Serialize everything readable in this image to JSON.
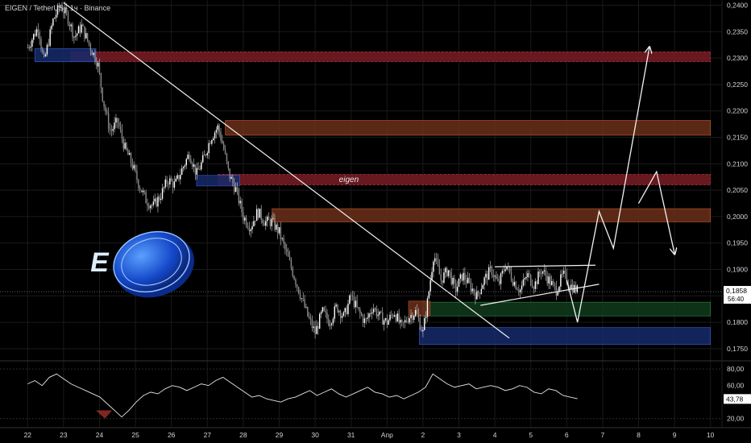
{
  "header": {
    "symbol": "EIGEN / TetherUS · 1ч · Binance"
  },
  "colors": {
    "background": "#000000",
    "text": "#d1d4dc",
    "grid": "#1a1a1a",
    "up": "#e6e6e6",
    "down": "#e6e6e6",
    "supply_zone": "#7a1c24",
    "supply_zone_orange": "#6b2f1a",
    "demand_zone": "#162a6b",
    "green_zone": "#0f3b1c"
  },
  "logo": {
    "name": "eigen-logo",
    "letters": "E"
  },
  "chart_data": {
    "type": "candlestick",
    "title": "",
    "price_axis": {
      "min": 0.173,
      "max": 0.241,
      "ticks": [
        "0,2400",
        "0,2350",
        "0,2300",
        "0,2250",
        "0,2200",
        "0,2150",
        "0,2100",
        "0,2050",
        "0,2000",
        "0,1950",
        "0,1900",
        "0,1850",
        "0,1800",
        "0,1750"
      ],
      "tick_values": [
        0.24,
        0.235,
        0.23,
        0.225,
        0.22,
        0.215,
        0.21,
        0.205,
        0.2,
        0.195,
        0.19,
        0.185,
        0.18,
        0.175
      ],
      "current_price": "0,1858",
      "current_value": 0.1858,
      "countdown": "56:40"
    },
    "time_axis": {
      "labels": [
        "22",
        "23",
        "24",
        "25",
        "26",
        "27",
        "28",
        "29",
        "30",
        "31",
        "Апр",
        "2",
        "3",
        "4",
        "5",
        "6",
        "7",
        "8",
        "9",
        "10"
      ],
      "day_index": [
        0,
        1,
        2,
        3,
        4,
        5,
        6,
        7,
        8,
        9,
        10,
        11,
        12,
        13,
        14,
        15,
        16,
        17,
        18,
        19
      ],
      "first_day_offset": 0.5
    },
    "zones": [
      {
        "label": "",
        "color": "supply",
        "day_from": 1.2,
        "day_to": 19.0,
        "low": 0.2293,
        "high": 0.2312
      },
      {
        "label": "",
        "color": "supply_orange",
        "day_from": 5.5,
        "day_to": 19.0,
        "low": 0.2154,
        "high": 0.2182
      },
      {
        "label": "eigen",
        "color": "supply",
        "day_from": 5.3,
        "day_to": 19.0,
        "low": 0.206,
        "high": 0.208
      },
      {
        "label": "",
        "color": "supply_orange",
        "day_from": 6.8,
        "day_to": 19.0,
        "low": 0.199,
        "high": 0.2015
      },
      {
        "label": "",
        "color": "green",
        "day_from": 11.0,
        "day_to": 19.0,
        "low": 0.1812,
        "high": 0.1838
      },
      {
        "label": "",
        "color": "demand",
        "day_from": 10.9,
        "day_to": 19.0,
        "low": 0.1758,
        "high": 0.179
      },
      {
        "label": "",
        "color": "demand",
        "day_from": 0.2,
        "day_to": 1.9,
        "low": 0.2293,
        "high": 0.2318
      },
      {
        "label": "",
        "color": "demand",
        "day_from": 4.7,
        "day_to": 5.9,
        "low": 0.2058,
        "high": 0.2078
      },
      {
        "label": "",
        "color": "supply_orange",
        "day_from": 10.6,
        "day_to": 11.2,
        "low": 0.1812,
        "high": 0.184
      }
    ],
    "price_path": [
      [
        0.0,
        0.232
      ],
      [
        0.3,
        0.236
      ],
      [
        0.45,
        0.229
      ],
      [
        0.7,
        0.237
      ],
      [
        0.9,
        0.24
      ],
      [
        1.1,
        0.238
      ],
      [
        1.3,
        0.234
      ],
      [
        1.5,
        0.236
      ],
      [
        1.75,
        0.232
      ],
      [
        1.95,
        0.229
      ],
      [
        2.1,
        0.222
      ],
      [
        2.3,
        0.216
      ],
      [
        2.5,
        0.218
      ],
      [
        2.7,
        0.213
      ],
      [
        2.9,
        0.21
      ],
      [
        3.1,
        0.206
      ],
      [
        3.3,
        0.203
      ],
      [
        3.5,
        0.202
      ],
      [
        3.7,
        0.204
      ],
      [
        3.9,
        0.207
      ],
      [
        4.1,
        0.206
      ],
      [
        4.3,
        0.209
      ],
      [
        4.5,
        0.212
      ],
      [
        4.7,
        0.208
      ],
      [
        4.9,
        0.211
      ],
      [
        5.1,
        0.215
      ],
      [
        5.3,
        0.217
      ],
      [
        5.45,
        0.213
      ],
      [
        5.6,
        0.208
      ],
      [
        5.8,
        0.205
      ],
      [
        6.0,
        0.2
      ],
      [
        6.2,
        0.198
      ],
      [
        6.4,
        0.201
      ],
      [
        6.6,
        0.199
      ],
      [
        6.8,
        0.199
      ],
      [
        7.0,
        0.197
      ],
      [
        7.2,
        0.193
      ],
      [
        7.4,
        0.189
      ],
      [
        7.6,
        0.185
      ],
      [
        7.8,
        0.181
      ],
      [
        8.0,
        0.178
      ],
      [
        8.2,
        0.182
      ],
      [
        8.4,
        0.18
      ],
      [
        8.6,
        0.183
      ],
      [
        8.8,
        0.181
      ],
      [
        9.0,
        0.185
      ],
      [
        9.2,
        0.182
      ],
      [
        9.4,
        0.18
      ],
      [
        9.6,
        0.183
      ],
      [
        9.8,
        0.181
      ],
      [
        10.0,
        0.18
      ],
      [
        10.2,
        0.182
      ],
      [
        10.4,
        0.179
      ],
      [
        10.6,
        0.181
      ],
      [
        10.8,
        0.182
      ],
      [
        11.0,
        0.178
      ],
      [
        11.15,
        0.185
      ],
      [
        11.3,
        0.193
      ],
      [
        11.5,
        0.188
      ],
      [
        11.7,
        0.19
      ],
      [
        11.9,
        0.186
      ],
      [
        12.1,
        0.189
      ],
      [
        12.3,
        0.187
      ],
      [
        12.5,
        0.185
      ],
      [
        12.7,
        0.188
      ],
      [
        12.9,
        0.19
      ],
      [
        13.1,
        0.187
      ],
      [
        13.3,
        0.191
      ],
      [
        13.5,
        0.188
      ],
      [
        13.7,
        0.186
      ],
      [
        13.9,
        0.189
      ],
      [
        14.1,
        0.187
      ],
      [
        14.3,
        0.19
      ],
      [
        14.5,
        0.188
      ],
      [
        14.7,
        0.186
      ],
      [
        14.9,
        0.189
      ],
      [
        15.1,
        0.187
      ],
      [
        15.3,
        0.186
      ]
    ],
    "trendline_main": {
      "from": [
        1.0,
        0.2405
      ],
      "to": [
        13.4,
        0.177
      ]
    },
    "pattern_lines": [
      {
        "from": [
          13.0,
          0.1905
        ],
        "to": [
          15.8,
          0.1908
        ]
      },
      {
        "from": [
          12.6,
          0.1832
        ],
        "to": [
          15.9,
          0.1872
        ]
      }
    ],
    "projection_up": [
      [
        15.0,
        0.188
      ],
      [
        15.3,
        0.18
      ],
      [
        15.9,
        0.201
      ],
      [
        16.3,
        0.194
      ],
      [
        17.3,
        0.232
      ]
    ],
    "projection_down": [
      [
        17.0,
        0.2025
      ],
      [
        17.5,
        0.2085
      ],
      [
        18.0,
        0.193
      ]
    ],
    "indicator": {
      "name": "RSI",
      "ticks": [
        "80,00",
        "60,00",
        "20,00"
      ],
      "tick_values": [
        80,
        60,
        20
      ],
      "min": 10,
      "max": 86,
      "current": "43,78",
      "current_value": 43.78,
      "values": [
        62,
        66,
        60,
        70,
        74,
        68,
        62,
        58,
        54,
        50,
        46,
        38,
        30,
        22,
        30,
        40,
        48,
        52,
        50,
        56,
        60,
        58,
        54,
        58,
        62,
        60,
        66,
        70,
        64,
        58,
        52,
        46,
        48,
        44,
        42,
        40,
        44,
        46,
        50,
        54,
        48,
        52,
        56,
        50,
        46,
        50,
        54,
        58,
        52,
        50,
        46,
        48,
        44,
        48,
        52,
        58,
        74,
        68,
        62,
        58,
        60,
        62,
        56,
        58,
        60,
        58,
        54,
        56,
        60,
        58,
        52,
        50,
        56,
        54,
        48,
        46,
        44
      ]
    }
  }
}
